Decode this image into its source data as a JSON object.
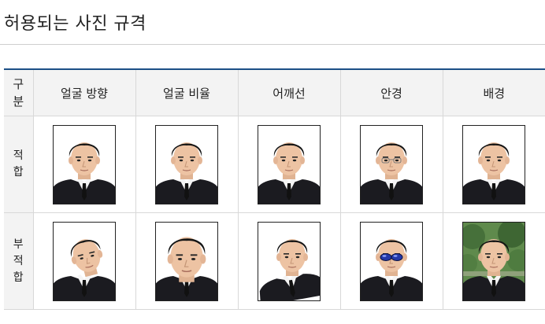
{
  "page": {
    "title": "허용되는 사진 규격"
  },
  "table": {
    "corner_label": "구분",
    "columns": [
      "얼굴 방향",
      "얼굴 비율",
      "어깨선",
      "안경",
      "배경"
    ],
    "rows": [
      {
        "label": "적합",
        "photos": [
          "정면 사진",
          "정면 사진",
          "정면 사진",
          "투명 안경 사진",
          "흰 배경 사진"
        ]
      },
      {
        "label": "부적합",
        "photos": [
          "얼굴 기울어짐",
          "얼굴 과다 확대",
          "어깨 기울어짐",
          "색안경 착용",
          "배경 불량"
        ]
      }
    ]
  }
}
